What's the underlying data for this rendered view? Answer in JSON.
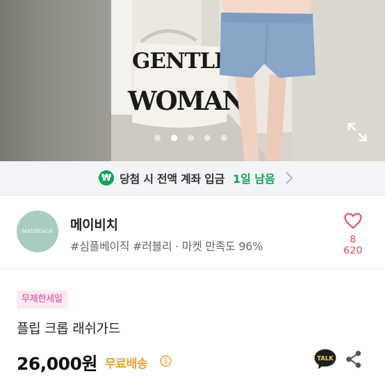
{
  "hero": {
    "bag_text_line1": "GENTLE",
    "bag_text_line2": "WOMAN",
    "slide_count": 5,
    "active_slide": 2
  },
  "banner": {
    "text": "당첨 시 전액 계좌 입금",
    "days_left": "1일 남음",
    "accent_color": "#10a25a"
  },
  "shop": {
    "logo_text": "MAYBEACH",
    "name": "메이비치",
    "tags": "#심플베이직 #러블리 · 마켓 만족도 96%",
    "like_count": "8 620",
    "like_color": "#e0455a"
  },
  "product": {
    "sale_badge": "무제한세일",
    "title": "플립 크롭 래쉬가드",
    "price": "26,000원",
    "shipping": "무료배송",
    "talk_label": "TALK"
  }
}
